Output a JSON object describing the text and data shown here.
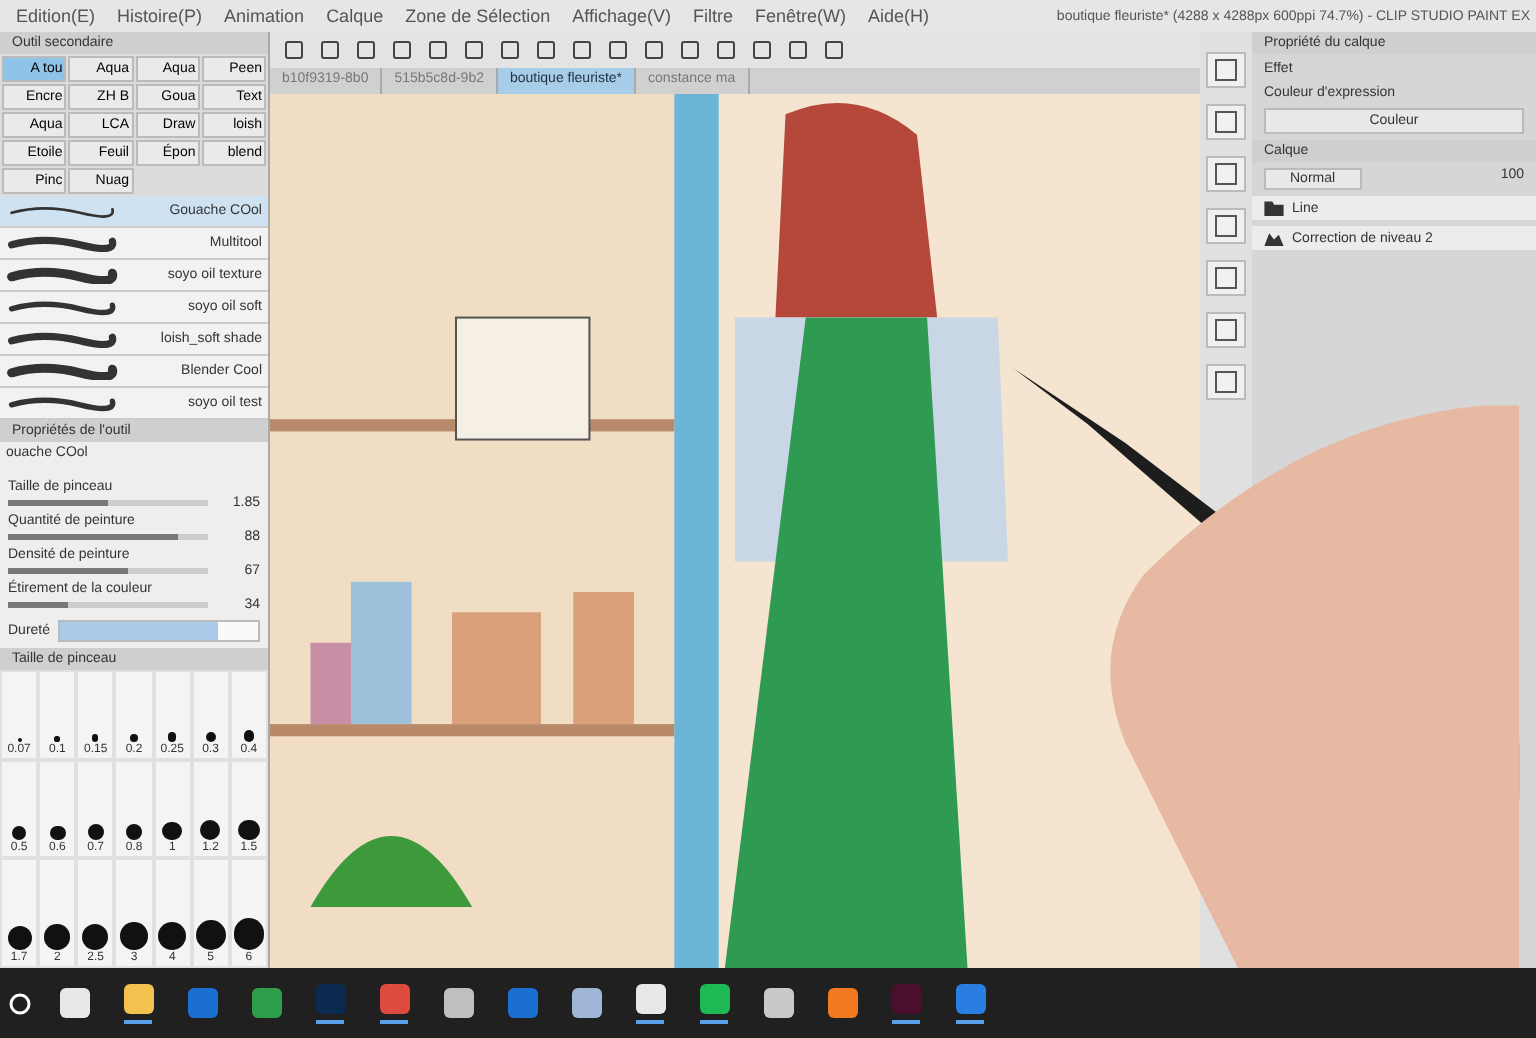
{
  "menu": [
    "Edition(E)",
    "Histoire(P)",
    "Animation",
    "Calque",
    "Zone de Sélection",
    "Affichage(V)",
    "Filtre",
    "Fenêtre(W)",
    "Aide(H)"
  ],
  "title": "boutique fleuriste* (4288 x 4288px 600ppi 74.7%) - CLIP STUDIO PAINT EX",
  "tabs": [
    {
      "label": "b10f9319-8b0",
      "selected": false
    },
    {
      "label": "515b5c8d-9b2",
      "selected": false
    },
    {
      "label": "boutique fleuriste*",
      "selected": true
    },
    {
      "label": "constance ma",
      "selected": false
    }
  ],
  "sub_tool": {
    "title": "Outil secondaire",
    "tools": [
      {
        "label": "A tou",
        "selected": true
      },
      {
        "label": "Aqua",
        "selected": false
      },
      {
        "label": "Aqua",
        "selected": false
      },
      {
        "label": "Peen",
        "selected": false
      },
      {
        "label": "Encre",
        "selected": false
      },
      {
        "label": "ZH B",
        "selected": false
      },
      {
        "label": "Goua",
        "selected": false
      },
      {
        "label": "Text",
        "selected": false
      },
      {
        "label": "Aqua",
        "selected": false
      },
      {
        "label": "LCA",
        "selected": false
      },
      {
        "label": "Draw",
        "selected": false
      },
      {
        "label": "loish",
        "selected": false
      },
      {
        "label": "Etoile",
        "selected": false
      },
      {
        "label": "Feuil",
        "selected": false
      },
      {
        "label": "Épon",
        "selected": false
      },
      {
        "label": "blend",
        "selected": false
      },
      {
        "label": "Pinc",
        "selected": false
      },
      {
        "label": "Nuag",
        "selected": false
      }
    ],
    "brushes": [
      {
        "name": "Gouache COol",
        "selected": true
      },
      {
        "name": "Multitool",
        "selected": false
      },
      {
        "name": "soyo oil texture",
        "selected": false
      },
      {
        "name": "soyo oil soft",
        "selected": false
      },
      {
        "name": "loish_soft shade",
        "selected": false
      },
      {
        "name": "Blender Cool",
        "selected": false
      },
      {
        "name": "soyo oil test",
        "selected": false
      }
    ]
  },
  "tool_property": {
    "title": "Propriétés de l'outil",
    "brush": "ouache COol",
    "settings": [
      {
        "label": "Taille de pinceau",
        "value": "1.85",
        "level": 0.5
      },
      {
        "label": "Quantité de peinture",
        "value": "88",
        "level": 0.85
      },
      {
        "label": "Densité de peinture",
        "value": "67",
        "level": 0.6
      },
      {
        "label": "Étirement de la couleur",
        "value": "34",
        "level": 0.3
      }
    ],
    "hardness": {
      "label": "Dureté",
      "level": 0.8
    }
  },
  "brush_size": {
    "title": "Taille de pinceau",
    "rows": [
      [
        "0.07",
        "0.1",
        "0.15",
        "0.2",
        "0.25",
        "0.3",
        "0.4"
      ],
      [
        "0.5",
        "0.6",
        "0.7",
        "0.8",
        "1",
        "1.2",
        "1.5"
      ],
      [
        "1.7",
        "2",
        "2.5",
        "3",
        "4",
        "5",
        "6"
      ]
    ]
  },
  "layer_property": {
    "title": "Propriété du calque",
    "effect": "Effet",
    "expression_label": "Couleur d'expression",
    "expression": "Couleur"
  },
  "layers": {
    "title": "Calque",
    "blend": "Normal",
    "opacity": "100",
    "items": [
      {
        "name": "Line",
        "kind": "folder"
      },
      {
        "name": "Correction de niveau 2",
        "kind": "adjust"
      }
    ]
  },
  "taskbar": [
    {
      "kind": "store",
      "running": false
    },
    {
      "kind": "folder",
      "running": true
    },
    {
      "kind": "mail",
      "running": false
    },
    {
      "kind": "note",
      "running": false
    },
    {
      "kind": "ps",
      "running": true
    },
    {
      "kind": "browser",
      "running": true
    },
    {
      "kind": "printer",
      "running": false
    },
    {
      "kind": "mail",
      "running": false
    },
    {
      "kind": "files",
      "running": false
    },
    {
      "kind": "clip",
      "running": true
    },
    {
      "kind": "music",
      "running": true
    },
    {
      "kind": "clock",
      "running": false
    },
    {
      "kind": "firefox",
      "running": false
    },
    {
      "kind": "id",
      "running": true
    },
    {
      "kind": "photos",
      "running": true
    }
  ]
}
